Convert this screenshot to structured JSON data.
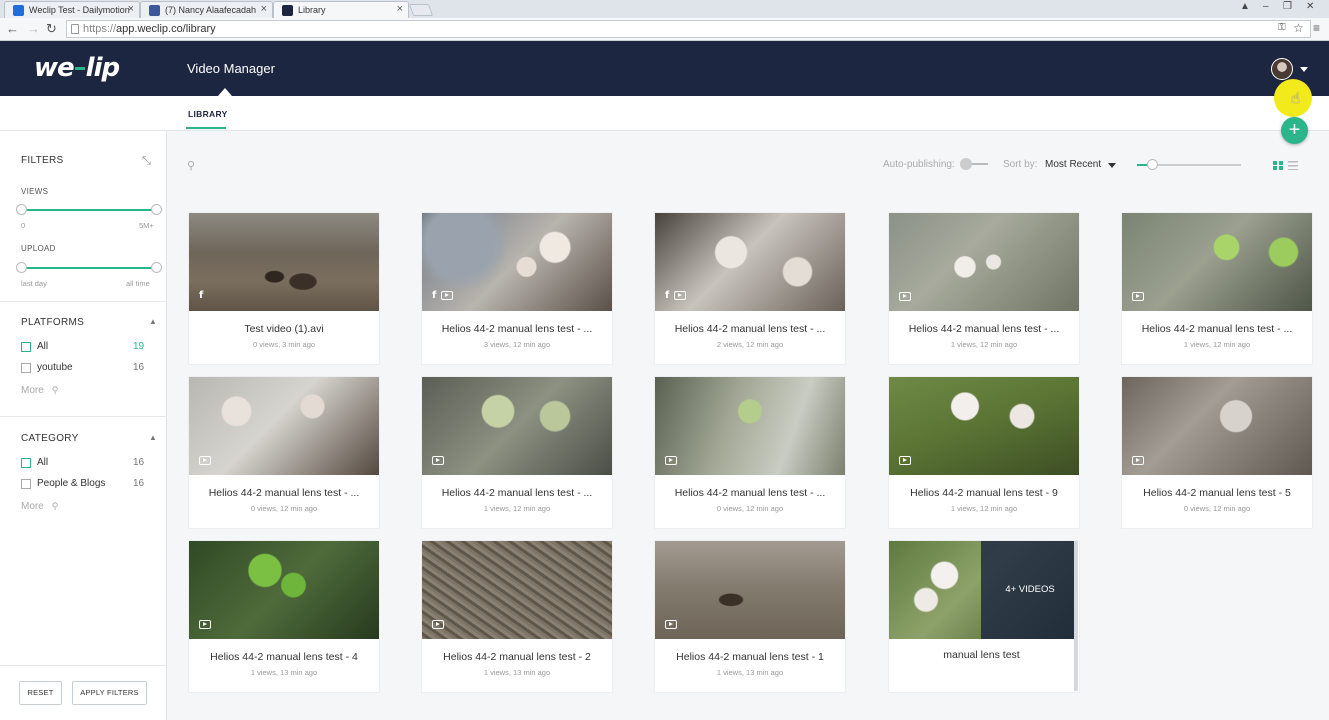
{
  "browser": {
    "tabs": [
      {
        "title": "Weclip Test - Dailymotion",
        "favicon_color": "#1d6ed8"
      },
      {
        "title": "(7) Nancy Alaafecadah",
        "favicon_color": "#3b5998"
      },
      {
        "title": "Library",
        "favicon_color": "#1c2640"
      }
    ],
    "url_proto": "https://",
    "url_rest": "app.weclip.co/library"
  },
  "header": {
    "logo": "weclip",
    "title": "Video Manager"
  },
  "subnav": {
    "tab": "LIBRARY"
  },
  "fab_label": "+",
  "filters": {
    "title": "FILTERS",
    "views": {
      "label": "VIEWS",
      "min": "0",
      "max": "5M+"
    },
    "upload": {
      "label": "UPLOAD",
      "min": "last day",
      "max": "all time"
    },
    "platforms": {
      "title": "PLATFORMS",
      "items": [
        {
          "label": "All",
          "count": "19"
        },
        {
          "label": "youtube",
          "count": "16"
        }
      ],
      "more": "More"
    },
    "category": {
      "title": "CATEGORY",
      "items": [
        {
          "label": "All",
          "count": "16"
        },
        {
          "label": "People & Blogs",
          "count": "16"
        }
      ],
      "more": "More"
    },
    "reset": "RESET",
    "apply": "APPLY FILTERS"
  },
  "toolbar": {
    "autopublishing": "Auto-publishing:",
    "toggle_label": "off",
    "sort_label": "Sort by:",
    "sort_value": "Most Recent"
  },
  "videos": [
    {
      "title": "Test video (1).avi",
      "meta": "0 views, 3 min ago"
    },
    {
      "title": "Helios 44-2 manual lens test - ...",
      "meta": "3 views, 12 min ago"
    },
    {
      "title": "Helios 44-2 manual lens test - ...",
      "meta": "2 views, 12 min ago"
    },
    {
      "title": "Helios 44-2 manual lens test - ...",
      "meta": "1 views, 12 min ago"
    },
    {
      "title": "Helios 44-2 manual lens test - ...",
      "meta": "1 views, 12 min ago"
    },
    {
      "title": "Helios 44-2 manual lens test - ...",
      "meta": "0 views, 12 min ago"
    },
    {
      "title": "Helios 44-2 manual lens test - ...",
      "meta": "1 views, 12 min ago"
    },
    {
      "title": "Helios 44-2 manual lens test - ...",
      "meta": "0 views, 12 min ago"
    },
    {
      "title": "Helios 44-2 manual lens test - 9",
      "meta": "1 views, 12 min ago"
    },
    {
      "title": "Helios 44-2 manual lens test - 5",
      "meta": "0 views, 12 min ago"
    },
    {
      "title": "Helios 44-2 manual lens test - 4",
      "meta": "1 views, 13 min ago"
    },
    {
      "title": "Helios 44-2 manual lens test - 2",
      "meta": "1 views, 13 min ago"
    },
    {
      "title": "Helios 44-2 manual lens test - 1",
      "meta": "1 views, 13 min ago"
    }
  ],
  "playlist": {
    "title": "manual lens test",
    "overlay": "4+ VIDEOS"
  },
  "colors": {
    "accent": "#2bb58a",
    "header_bg": "#1c2640"
  }
}
